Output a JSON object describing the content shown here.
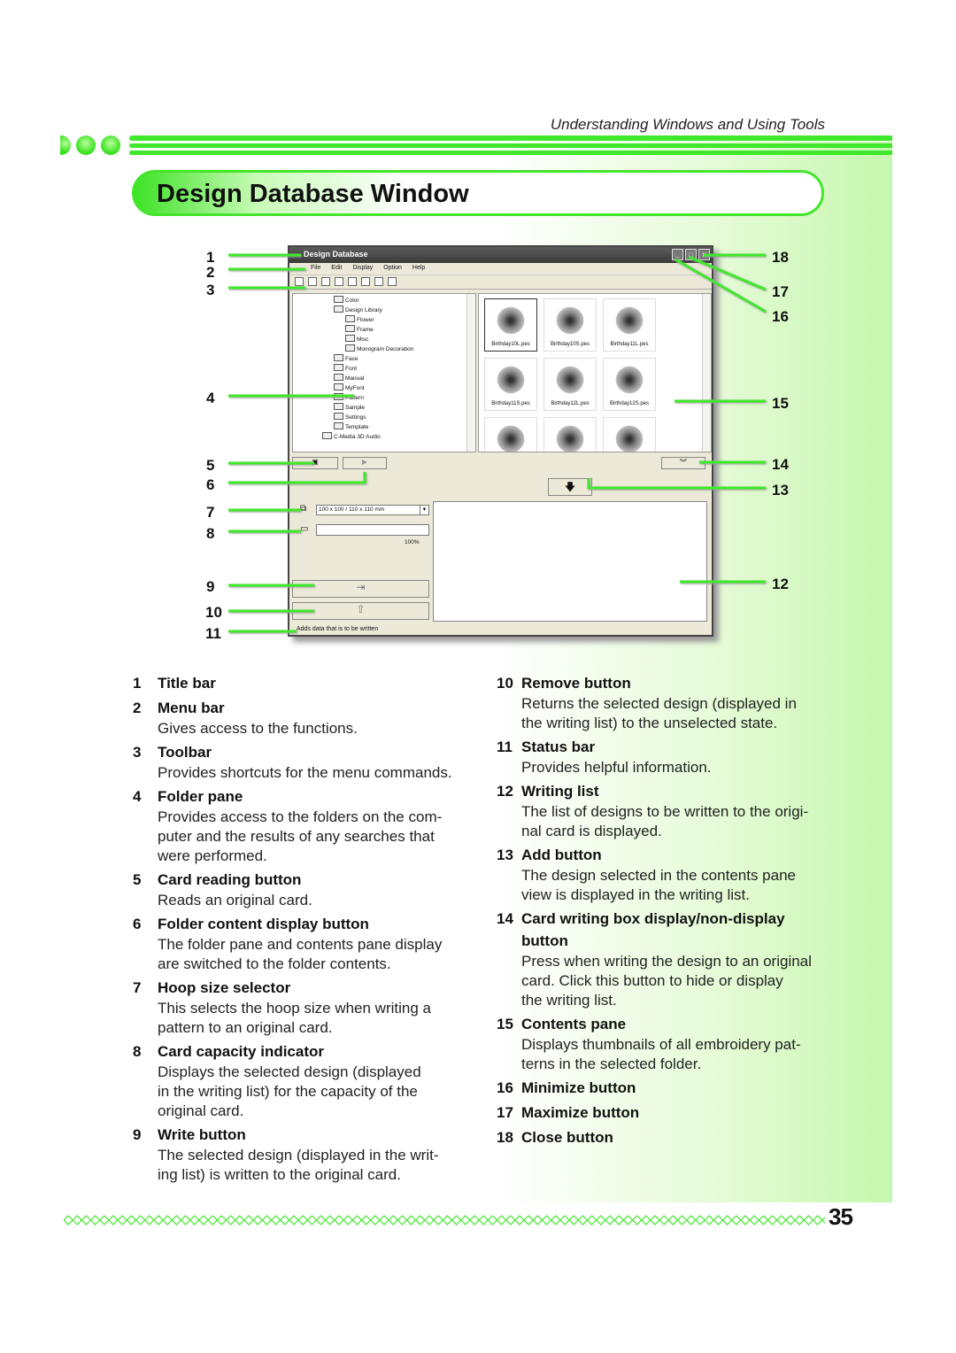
{
  "header": {
    "running_title": "Understanding Windows and Using Tools",
    "section_title": "Design Database Window",
    "accent_color": "#3fe82a"
  },
  "window": {
    "title": "Design Database",
    "controls": {
      "minimize": "_",
      "maximize": "□",
      "close": "x"
    },
    "menu": [
      "File",
      "Edit",
      "Display",
      "Option",
      "Help"
    ],
    "toolbar_icons": [
      "cut-icon",
      "copy-icon",
      "paste-icon",
      "large-thumbnail-icon",
      "medium-thumbnail-icon",
      "small-thumbnail-icon",
      "properties-icon",
      "search-icon"
    ],
    "folders": [
      {
        "label": "Color",
        "level": 2
      },
      {
        "label": "Design Library",
        "level": 2
      },
      {
        "label": "Flower",
        "level": 3
      },
      {
        "label": "Frame",
        "level": 3
      },
      {
        "label": "Misc",
        "level": 3
      },
      {
        "label": "Monogram Decoration",
        "level": 3
      },
      {
        "label": "Face",
        "level": 2
      },
      {
        "label": "Font",
        "level": 2
      },
      {
        "label": "Manual",
        "level": 2
      },
      {
        "label": "MyFont",
        "level": 2
      },
      {
        "label": "Pattern",
        "level": 2
      },
      {
        "label": "Sample",
        "level": 2
      },
      {
        "label": "Settings",
        "level": 2
      },
      {
        "label": "Template",
        "level": 2
      },
      {
        "label": "C-Media 3D Audio",
        "level": 1
      }
    ],
    "thumbnails": [
      "Birthday10L.pes",
      "Birthday10S.pes",
      "Birthday11L.pes",
      "Birthday11S.pes",
      "Birthday12L.pes",
      "Birthday12S.pes",
      "",
      "",
      ""
    ],
    "hoop_size": "100 x 100 / 110 x 110 mm",
    "capacity": {
      "percent_label": "100%",
      "fill": 0
    },
    "status": "Adds data that is to be written"
  },
  "callouts": {
    "left": [
      "1",
      "2",
      "3",
      "4",
      "5",
      "6",
      "7",
      "8",
      "9",
      "10",
      "11"
    ],
    "right": [
      "18",
      "17",
      "16",
      "15",
      "14",
      "13",
      "12"
    ]
  },
  "items_left": [
    {
      "n": "1",
      "title": "Title bar",
      "desc": ""
    },
    {
      "n": "2",
      "title": "Menu bar",
      "desc": "Gives access to the functions."
    },
    {
      "n": "3",
      "title": "Toolbar",
      "desc": "Provides shortcuts for the menu commands."
    },
    {
      "n": "4",
      "title": "Folder pane",
      "desc": "Provides access to the folders on the com-\nputer and the results of any searches that\nwere performed."
    },
    {
      "n": "5",
      "title": "Card reading button",
      "desc": "Reads an original card."
    },
    {
      "n": "6",
      "title": "Folder content display button",
      "desc": "The folder pane and contents pane display\nare switched to the folder contents."
    },
    {
      "n": "7",
      "title": "Hoop size selector",
      "desc": "This selects the hoop size when writing a\npattern to an original card."
    },
    {
      "n": "8",
      "title": "Card capacity indicator",
      "desc": "Displays the selected design (displayed\nin the writing list) for the capacity of the\noriginal card."
    },
    {
      "n": "9",
      "title": "Write button",
      "desc": "The selected design (displayed in the writ-\ning list) is written to the original card."
    }
  ],
  "items_right": [
    {
      "n": "10",
      "title": "Remove button",
      "desc": "Returns the selected design (displayed in\nthe writing list) to the unselected state."
    },
    {
      "n": "11",
      "title": "Status bar",
      "desc": "Provides helpful information."
    },
    {
      "n": "12",
      "title": "Writing list",
      "desc": "The list of designs to be written to the origi-\nnal card is displayed."
    },
    {
      "n": "13",
      "title": "Add button",
      "desc": "The design selected in the contents pane\nview is displayed in the writing list."
    },
    {
      "n": "14",
      "title": "Card writing box display/non-display\nbutton",
      "desc": "Press when writing the design to an original\ncard. Click this button to hide or display\nthe writing list."
    },
    {
      "n": "15",
      "title": "Contents pane",
      "desc": "Displays thumbnails of all embroidery pat-\nterns in the selected folder."
    },
    {
      "n": "16",
      "title": "Minimize button",
      "desc": ""
    },
    {
      "n": "17",
      "title": "Maximize button",
      "desc": ""
    },
    {
      "n": "18",
      "title": "Close button",
      "desc": ""
    }
  ],
  "footer": {
    "page_number": "35"
  }
}
